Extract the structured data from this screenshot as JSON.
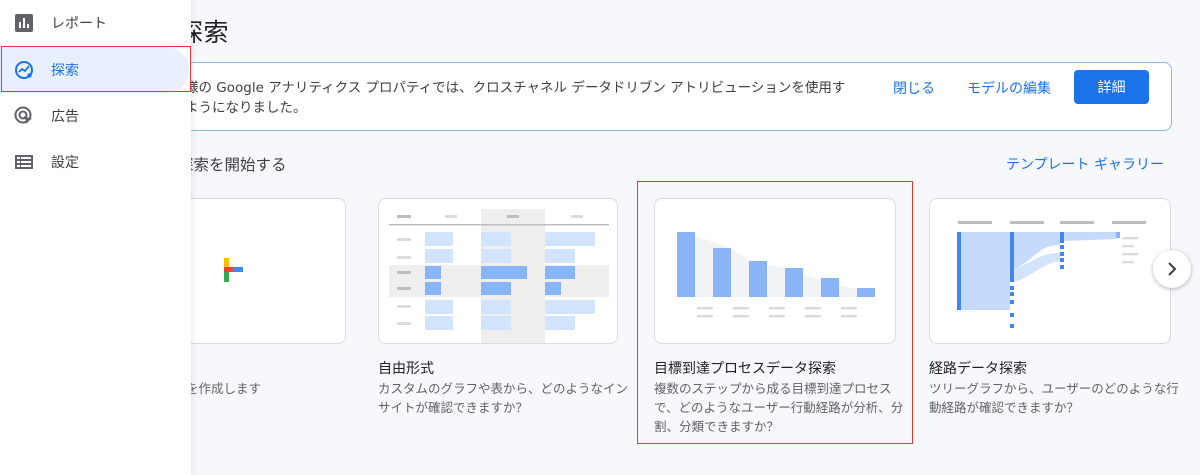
{
  "sidebar": {
    "items": [
      {
        "label": "レポート",
        "icon": "bar-chart-icon"
      },
      {
        "label": "探索",
        "icon": "explore-icon",
        "active": true
      },
      {
        "label": "広告",
        "icon": "advertising-icon"
      },
      {
        "label": "設定",
        "icon": "settings-list-icon"
      }
    ]
  },
  "page": {
    "title": "探索"
  },
  "banner": {
    "text": "様の Google アナリティクス プロパティでは、クロスチャネル データドリブン アトリビューションを使用す\nようになりました。",
    "close_label": "閉じる",
    "edit_label": "モデルの編集",
    "detail_label": "詳細"
  },
  "section": {
    "title": "探索を開始する",
    "gallery_label": "テンプレート ギャラリー"
  },
  "cards": [
    {
      "title": "",
      "desc": "を作成します"
    },
    {
      "title": "自由形式",
      "desc": "カスタムのグラフや表から、どのようなイン\nサイトが確認できますか？"
    },
    {
      "title": "目標到達プロセスデータ探索",
      "desc": "複数のステップから成る目標到達プロセス\nで、どのようなユーザー行動経路が分析、分\n割、分類できますか？"
    },
    {
      "title": "経路データ探索",
      "desc": "ツリーグラフから、ユーザーのどのような行\n動経路が確認できますか？"
    }
  ],
  "colors": {
    "accent": "#1a73e8",
    "highlight": "#e53935",
    "chart_blue": "#8ab4f8"
  }
}
